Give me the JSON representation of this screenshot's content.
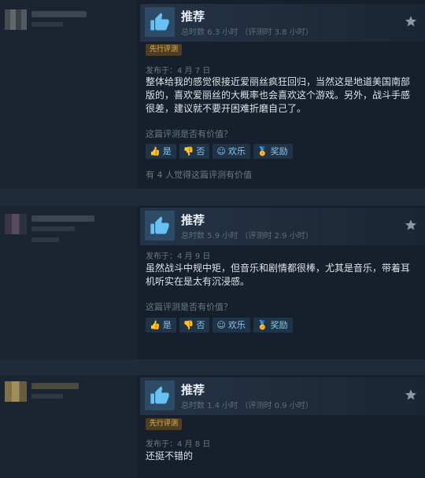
{
  "reviews": [
    {
      "verdict": "推荐",
      "hours": "总时数 6.3 小时  （评测时 3.8 小时）",
      "tag": "先行评测",
      "posted": "发布于：4 月 7 日",
      "body": "整体给我的感觉很接近爱丽丝疯狂回归，当然这是地道美国南部版的，喜欢爱丽丝的大概率也会喜欢这个游戏。另外，战斗手感很差，建议就不要开困难折磨自己了。",
      "helpful_question": "这篇评测是否有价值？",
      "found_helpful": "有 4 人觉得这篇评测有价值"
    },
    {
      "verdict": "推荐",
      "hours": "总时数 5.9 小时  （评测时 2.9 小时）",
      "posted": "发布于：4 月 9 日",
      "body": "虽然战斗中规中矩，但音乐和剧情都很棒，尤其是音乐，带着耳机听实在是太有沉浸感。",
      "helpful_question": "这篇评测是否有价值？"
    },
    {
      "verdict": "推荐",
      "hours": "总时数 1.4 小时  （评测时 0.9 小时）",
      "tag": "先行评测",
      "posted": "发布于：4 月 8 日",
      "body": "还挺不错的"
    }
  ],
  "buttons": {
    "yes": "是",
    "no": "否",
    "funny": "欢乐",
    "award": "奖励"
  },
  "icons": {
    "thumb": "thumbs-up-icon",
    "star": "star-icon"
  },
  "colors": {
    "accent": "#67c1f5",
    "tag_text": "#e2b65d"
  }
}
